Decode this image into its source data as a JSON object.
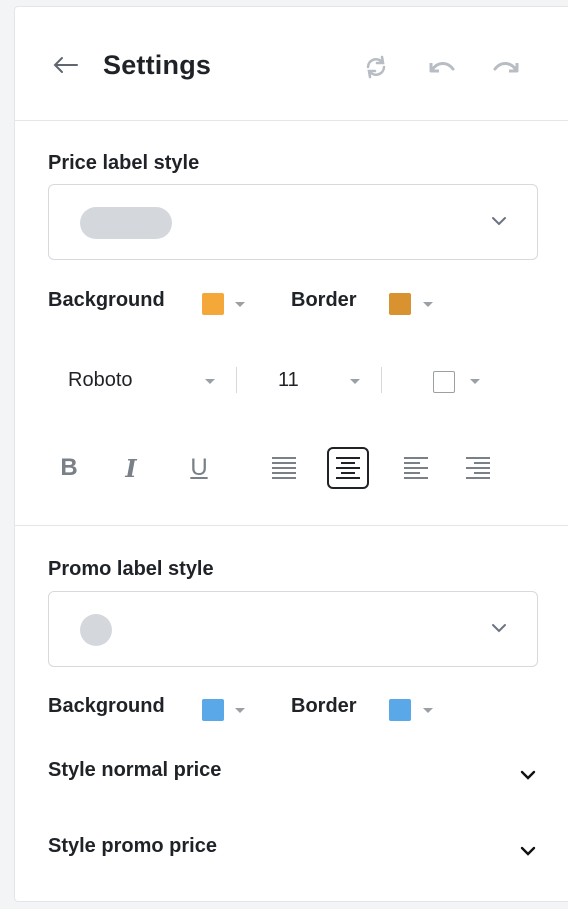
{
  "header": {
    "title": "Settings",
    "icons": [
      "back-arrow-icon",
      "refresh-icon",
      "undo-icon",
      "redo-icon"
    ]
  },
  "price_label": {
    "title": "Price label style",
    "background_label": "Background",
    "border_label": "Border",
    "background_color": "#f5a83a",
    "border_color": "#d89230",
    "font_family": "Roboto",
    "font_size": "11",
    "text_color": "#ffffff",
    "format_tools": [
      "bold-icon",
      "italic-icon",
      "underline-icon",
      "align-justify-icon",
      "align-center-icon",
      "align-left-icon",
      "align-right-icon"
    ],
    "format_letters": {
      "bold": "B",
      "italic": "I",
      "underline": "U"
    },
    "active_alignment": "align-center"
  },
  "promo_label": {
    "title": "Promo label style",
    "background_label": "Background",
    "border_label": "Border",
    "background_color": "#5aa8e8",
    "border_color": "#5aa8e8"
  },
  "sections": {
    "normal_price": "Style normal price",
    "promo_price": "Style promo price"
  }
}
